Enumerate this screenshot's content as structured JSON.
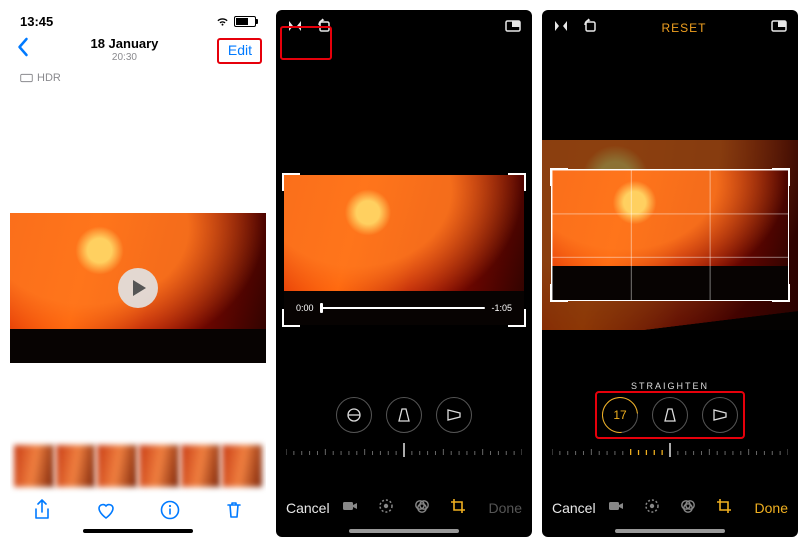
{
  "panel1": {
    "time": "13:45",
    "date": "18 January",
    "subtime": "20:30",
    "edit": "Edit",
    "hdr": "HDR"
  },
  "panel2": {
    "trim_start": "0:00",
    "trim_end": "1:05",
    "cancel": "Cancel",
    "done": "Done"
  },
  "panel3": {
    "reset": "RESET",
    "straighten_label": "STRAIGHTEN",
    "straighten_value": "17",
    "cancel": "Cancel",
    "done": "Done"
  }
}
